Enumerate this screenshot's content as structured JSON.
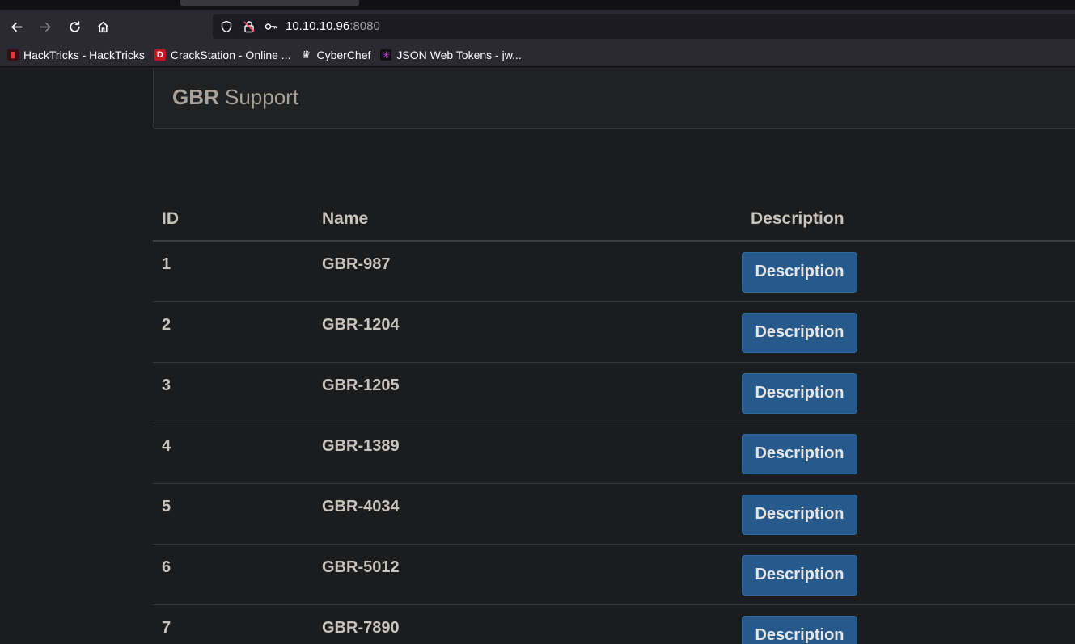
{
  "browser": {
    "url_host": "10.10.10.96",
    "url_port": ":8080",
    "bookmarks": [
      {
        "label": "HackTricks - HackTricks",
        "icon": "hacktricks-icon"
      },
      {
        "label": "CrackStation - Online ...",
        "icon": "crackstation-icon"
      },
      {
        "label": "CyberChef",
        "icon": "cyberchef-icon"
      },
      {
        "label": "JSON Web Tokens - jw...",
        "icon": "jwt-icon"
      }
    ]
  },
  "site": {
    "brand_bold": "GBR",
    "brand_rest": " Support"
  },
  "table": {
    "headers": [
      "ID",
      "Name",
      "Description"
    ],
    "button_label": "Description",
    "rows": [
      {
        "id": "1",
        "name": "GBR-987"
      },
      {
        "id": "2",
        "name": "GBR-1204"
      },
      {
        "id": "3",
        "name": "GBR-1205"
      },
      {
        "id": "4",
        "name": "GBR-1389"
      },
      {
        "id": "5",
        "name": "GBR-4034"
      },
      {
        "id": "6",
        "name": "GBR-5012"
      },
      {
        "id": "7",
        "name": "GBR-7890"
      }
    ]
  },
  "colors": {
    "button_bg": "#265a8c",
    "page_bg": "#1b1c1e",
    "chrome_bg": "#2b2a33"
  }
}
